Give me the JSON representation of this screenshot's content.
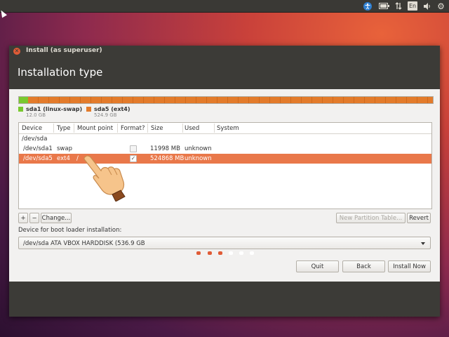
{
  "topbar": {
    "icons": [
      "accessibility-icon",
      "battery-icon",
      "network-icon",
      "keyboard-layout-indicator",
      "volume-icon",
      "gear-icon"
    ],
    "keyboard_layout": "En"
  },
  "window": {
    "title": "Install (as superuser)",
    "heading": "Installation type"
  },
  "partition_bar": {
    "legend": [
      {
        "name": "sda1 (linux-swap)",
        "size": "12.0 GB",
        "color": "#79c92f"
      },
      {
        "name": "sda5 (ext4)",
        "size": "524.9 GB",
        "color": "#e37b2b"
      }
    ]
  },
  "table": {
    "headers": [
      "Device",
      "Type",
      "Mount point",
      "Format?",
      "Size",
      "Used",
      "System"
    ],
    "rows": [
      {
        "device": "/dev/sda",
        "type": "",
        "mount": "",
        "format": null,
        "size": "",
        "used": "",
        "system": ""
      },
      {
        "device": "/dev/sda1",
        "type": "swap",
        "mount": "",
        "format": false,
        "size": "11998 MB",
        "used": "unknown",
        "system": ""
      },
      {
        "device": "/dev/sda5",
        "type": "ext4",
        "mount": "/",
        "format": true,
        "size": "524868 MB",
        "used": "unknown",
        "system": "",
        "selected": true
      }
    ]
  },
  "partition_buttons": {
    "add": "+",
    "remove": "−",
    "change": "Change...",
    "new_table": "New Partition Table...",
    "revert": "Revert"
  },
  "bootloader": {
    "label": "Device for boot loader installation:",
    "selected": "/dev/sda   ATA VBOX HARDDISK (536.9 GB"
  },
  "actions": {
    "quit": "Quit",
    "back": "Back",
    "install": "Install Now"
  },
  "progress": {
    "total_steps": 6,
    "completed_steps": 3,
    "active_color": "#e05b36",
    "inactive_color": "#ffffff"
  }
}
